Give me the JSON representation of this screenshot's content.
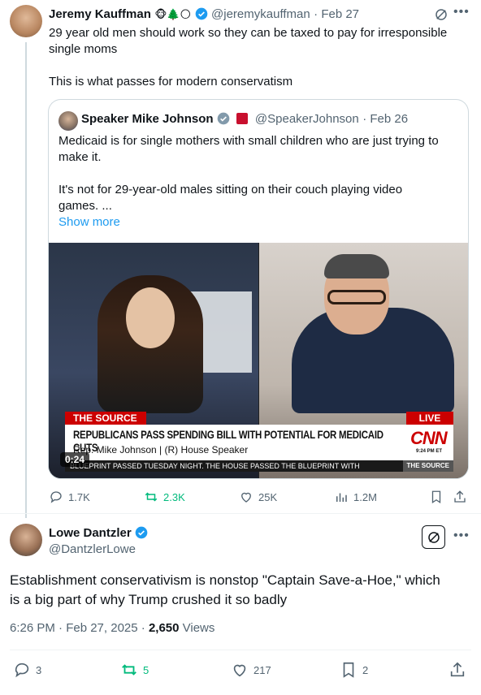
{
  "tweet1": {
    "name": "Jeremy Kauffman",
    "emojis": "🐵🌲🌕",
    "handle": "@jeremykauffman",
    "date": "· Feb 27",
    "text_line1": "29 year old men should work so they can be taxed to pay for irresponsible",
    "text_line2": "single moms",
    "text_line3": "This is what passes for modern conservatism",
    "stats": {
      "replies": "1.7K",
      "reposts": "2.3K",
      "likes": "25K",
      "views": "1.2M"
    }
  },
  "quote": {
    "name": "Speaker Mike Johnson",
    "handle": "@SpeakerJohnson",
    "date": "· Feb 26",
    "text_line1": "Medicaid is for single mothers with small children who are just trying to",
    "text_line2": "make it.",
    "text_line3": "It's not for 29-year-old males sitting on their couch playing video",
    "text_line4": "games. ...",
    "show_more": "Show more",
    "video": {
      "chyron_tag": "THE SOURCE",
      "live": "LIVE",
      "headline": "REPUBLICANS PASS SPENDING BILL WITH POTENTIAL FOR MEDICAID CUTS",
      "subtitle": "Rep. Mike Johnson  |  (R) House Speaker",
      "network": "CNN",
      "clock": "9:24 PM ET",
      "ticker": "BLUEPRINT PASSED TUESDAY NIGHT. THE HOUSE PASSED THE BLUEPRINT WITH",
      "ticker_tag": "THE SOURCE",
      "duration": "0:24"
    }
  },
  "tweet2": {
    "name": "Lowe Dantzler",
    "handle": "@DantzlerLowe",
    "text_line1": "Establishment conservativism is nonstop \"Captain Save-a-Hoe,\" which",
    "text_line2": "is a big part of why Trump crushed it so badly",
    "timestamp": "6:26 PM · Feb 27, 2025 · ",
    "views_count": "2,650",
    "views_label": " Views",
    "stats": {
      "replies": "3",
      "reposts": "5",
      "likes": "217",
      "bookmarks": "2"
    }
  },
  "colors": {
    "accent": "#1d9bf0",
    "repost": "#00ba7c",
    "muted": "#536471"
  }
}
